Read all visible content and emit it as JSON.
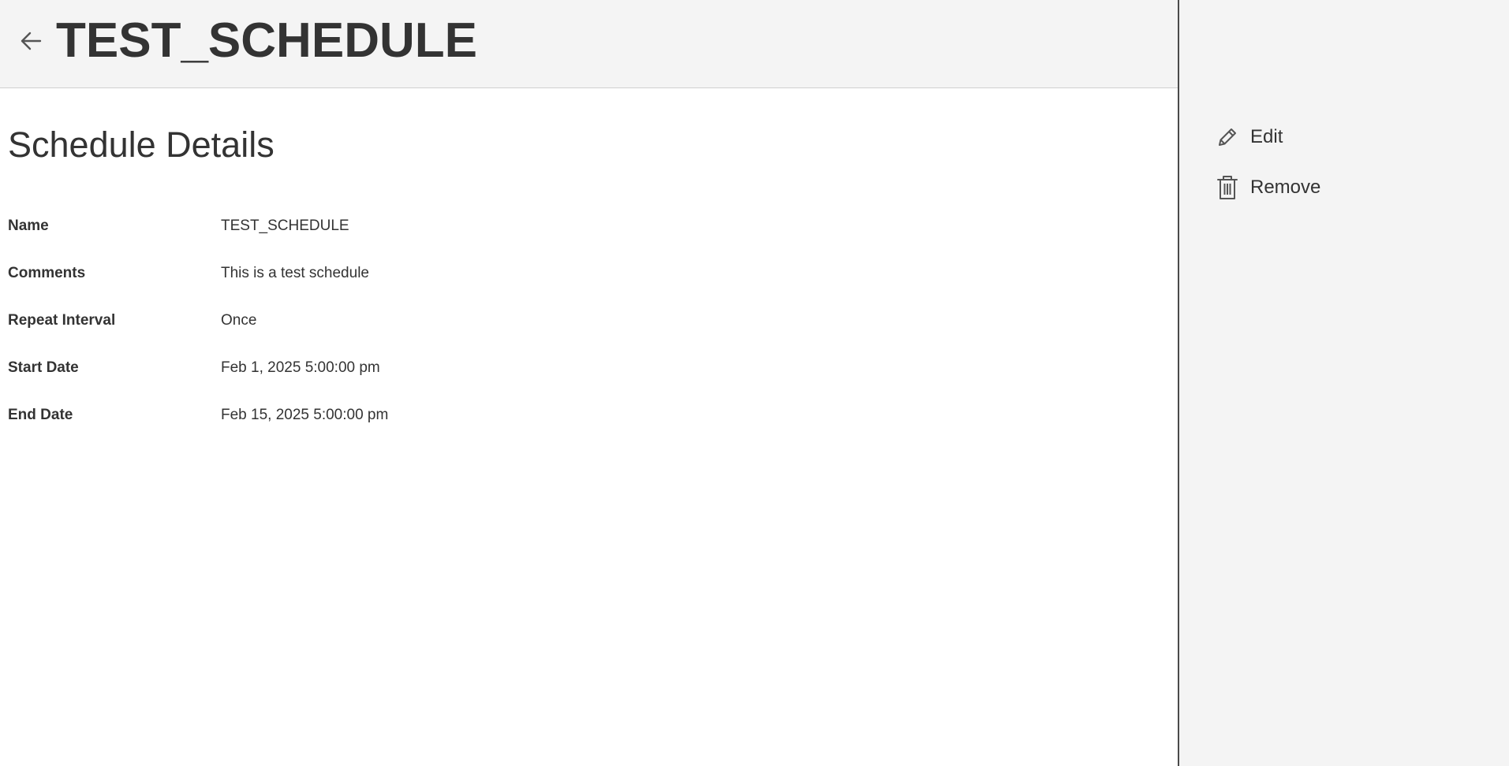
{
  "header": {
    "back_icon": "arrow-left-icon",
    "title": "TEST_SCHEDULE"
  },
  "section": {
    "title": "Schedule Details"
  },
  "details": [
    {
      "label": "Name",
      "value": "TEST_SCHEDULE"
    },
    {
      "label": "Comments",
      "value": "This is a test schedule"
    },
    {
      "label": "Repeat Interval",
      "value": "Once"
    },
    {
      "label": "Start Date",
      "value": "Feb 1, 2025 5:00:00 pm"
    },
    {
      "label": "End Date",
      "value": "Feb 15, 2025 5:00:00 pm"
    }
  ],
  "actions": {
    "edit": {
      "label": "Edit",
      "icon": "pencil-icon"
    },
    "remove": {
      "label": "Remove",
      "icon": "trash-icon"
    }
  },
  "colors": {
    "header_bg": "#f4f4f4",
    "panel_bg": "#f4f4f4",
    "text": "#333333",
    "divider": "#4a4a4a"
  }
}
